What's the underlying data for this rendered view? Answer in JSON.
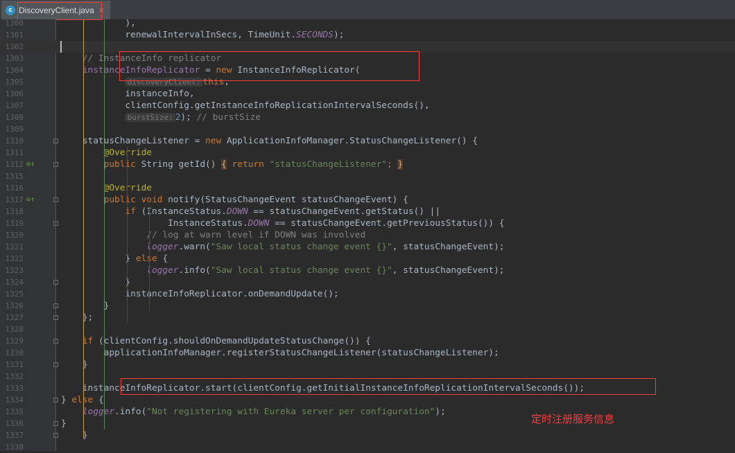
{
  "tab": {
    "icon": "c",
    "filename": "DiscoveryClient.java",
    "close": "×"
  },
  "annotation": "定时注册服务信息",
  "lines": [
    {
      "n": "1300",
      "t": [
        [
          "t",
          "            ),"
        ]
      ]
    },
    {
      "n": "1301",
      "t": [
        [
          "t",
          "            renewalIntervalInSecs, "
        ],
        [
          "t",
          "TimeUnit."
        ],
        [
          "fi",
          "SECONDS"
        ],
        [
          "t",
          ");"
        ]
      ]
    },
    {
      "n": "1302",
      "t": []
    },
    {
      "n": "1303",
      "t": [
        [
          "c",
          "    // InstanceInfo replicator"
        ]
      ]
    },
    {
      "n": "1304",
      "t": [
        [
          "f",
          "    instanceInfoReplicator"
        ],
        [
          "t",
          " = "
        ],
        [
          "k",
          "new "
        ],
        [
          "t",
          "InstanceInfoReplicator("
        ]
      ]
    },
    {
      "n": "1305",
      "t": [
        [
          "t",
          "            "
        ],
        [
          "hint",
          "discoveryClient:"
        ],
        [
          "k",
          "this"
        ],
        [
          "t",
          ","
        ]
      ]
    },
    {
      "n": "1306",
      "t": [
        [
          "t",
          "            instanceInfo,"
        ]
      ]
    },
    {
      "n": "1307",
      "t": [
        [
          "t",
          "            clientConfig.getInstanceInfoReplicationIntervalSeconds(),"
        ]
      ]
    },
    {
      "n": "1308",
      "t": [
        [
          "t",
          "            "
        ],
        [
          "hint",
          "burstSize:"
        ],
        [
          "n",
          "2"
        ],
        [
          "t",
          "); "
        ],
        [
          "c",
          "// burstSize"
        ]
      ]
    },
    {
      "n": "1309",
      "t": []
    },
    {
      "n": "1310",
      "t": [
        [
          "t",
          "    statusChangeListener = "
        ],
        [
          "k",
          "new "
        ],
        [
          "t",
          "ApplicationInfoManager.StatusChangeListener() {"
        ]
      ]
    },
    {
      "n": "1311",
      "t": [
        [
          "a",
          "        @Override"
        ]
      ]
    },
    {
      "n": "1312",
      "t": [
        [
          "k",
          "        public "
        ],
        [
          "t",
          "String getId() "
        ],
        [
          "brace",
          "{"
        ],
        [
          "k",
          " return "
        ],
        [
          "s",
          "\"statusChangeListener\""
        ],
        [
          "k",
          "; "
        ],
        [
          "brace",
          "}"
        ]
      ]
    },
    {
      "n": "1315",
      "t": []
    },
    {
      "n": "1316",
      "t": [
        [
          "a",
          "        @Override"
        ]
      ]
    },
    {
      "n": "1317",
      "t": [
        [
          "k",
          "        public void "
        ],
        [
          "t",
          "notify(StatusChangeEvent statusChangeEvent) {"
        ]
      ]
    },
    {
      "n": "1318",
      "t": [
        [
          "k",
          "            if "
        ],
        [
          "t",
          "(InstanceStatus."
        ],
        [
          "fi",
          "DOWN"
        ],
        [
          "t",
          " == statusChangeEvent.getStatus() ||"
        ]
      ]
    },
    {
      "n": "1319",
      "t": [
        [
          "t",
          "                    InstanceStatus."
        ],
        [
          "fi",
          "DOWN"
        ],
        [
          "t",
          " == statusChangeEvent.getPreviousStatus()) {"
        ]
      ]
    },
    {
      "n": "1320",
      "t": [
        [
          "c",
          "                // log at warn level if DOWN was involved"
        ]
      ]
    },
    {
      "n": "1321",
      "t": [
        [
          "fi",
          "                logger"
        ],
        [
          "t",
          ".warn("
        ],
        [
          "s",
          "\"Saw local status change event {}\""
        ],
        [
          "t",
          ", statusChangeEvent);"
        ]
      ]
    },
    {
      "n": "1322",
      "t": [
        [
          "t",
          "            } "
        ],
        [
          "k",
          "else "
        ],
        [
          "t",
          "{"
        ]
      ]
    },
    {
      "n": "1323",
      "t": [
        [
          "fi",
          "                logger"
        ],
        [
          "t",
          ".info("
        ],
        [
          "s",
          "\"Saw local status change event {}\""
        ],
        [
          "t",
          ", statusChangeEvent);"
        ]
      ]
    },
    {
      "n": "1324",
      "t": [
        [
          "t",
          "            }"
        ]
      ]
    },
    {
      "n": "1325",
      "t": [
        [
          "t",
          "            instanceInfoReplicator.onDemandUpdate();"
        ]
      ]
    },
    {
      "n": "1326",
      "t": [
        [
          "t",
          "        }"
        ]
      ]
    },
    {
      "n": "1327",
      "t": [
        [
          "t",
          "    };"
        ]
      ]
    },
    {
      "n": "1328",
      "t": []
    },
    {
      "n": "1329",
      "t": [
        [
          "k",
          "    if "
        ],
        [
          "t",
          "(clientConfig.shouldOnDemandUpdateStatusChange()) {"
        ]
      ]
    },
    {
      "n": "1330",
      "t": [
        [
          "t",
          "        applicationInfoManager.registerStatusChangeListener(statusChangeListener);"
        ]
      ]
    },
    {
      "n": "1331",
      "t": [
        [
          "t",
          "    }"
        ]
      ]
    },
    {
      "n": "1332",
      "t": []
    },
    {
      "n": "1333",
      "t": [
        [
          "t",
          "    instanceInfoReplicator.start(clientConfig.getInitialInstanceInfoReplicationIntervalSeconds());"
        ]
      ]
    },
    {
      "n": "1334",
      "t": [
        [
          "t",
          "} "
        ],
        [
          "k",
          "else "
        ],
        [
          "t",
          "{"
        ]
      ]
    },
    {
      "n": "1335",
      "t": [
        [
          "fi",
          "    logger"
        ],
        [
          "t",
          ".info("
        ],
        [
          "s",
          "\"Not registering with Eureka server per configuration\""
        ],
        [
          "t",
          ");"
        ]
      ]
    },
    {
      "n": "1336",
      "t": [
        [
          "t",
          "}"
        ]
      ]
    },
    {
      "n": "1337",
      "t": [
        [
          "t",
          "    }"
        ]
      ]
    },
    {
      "n": "1338",
      "t": []
    }
  ]
}
